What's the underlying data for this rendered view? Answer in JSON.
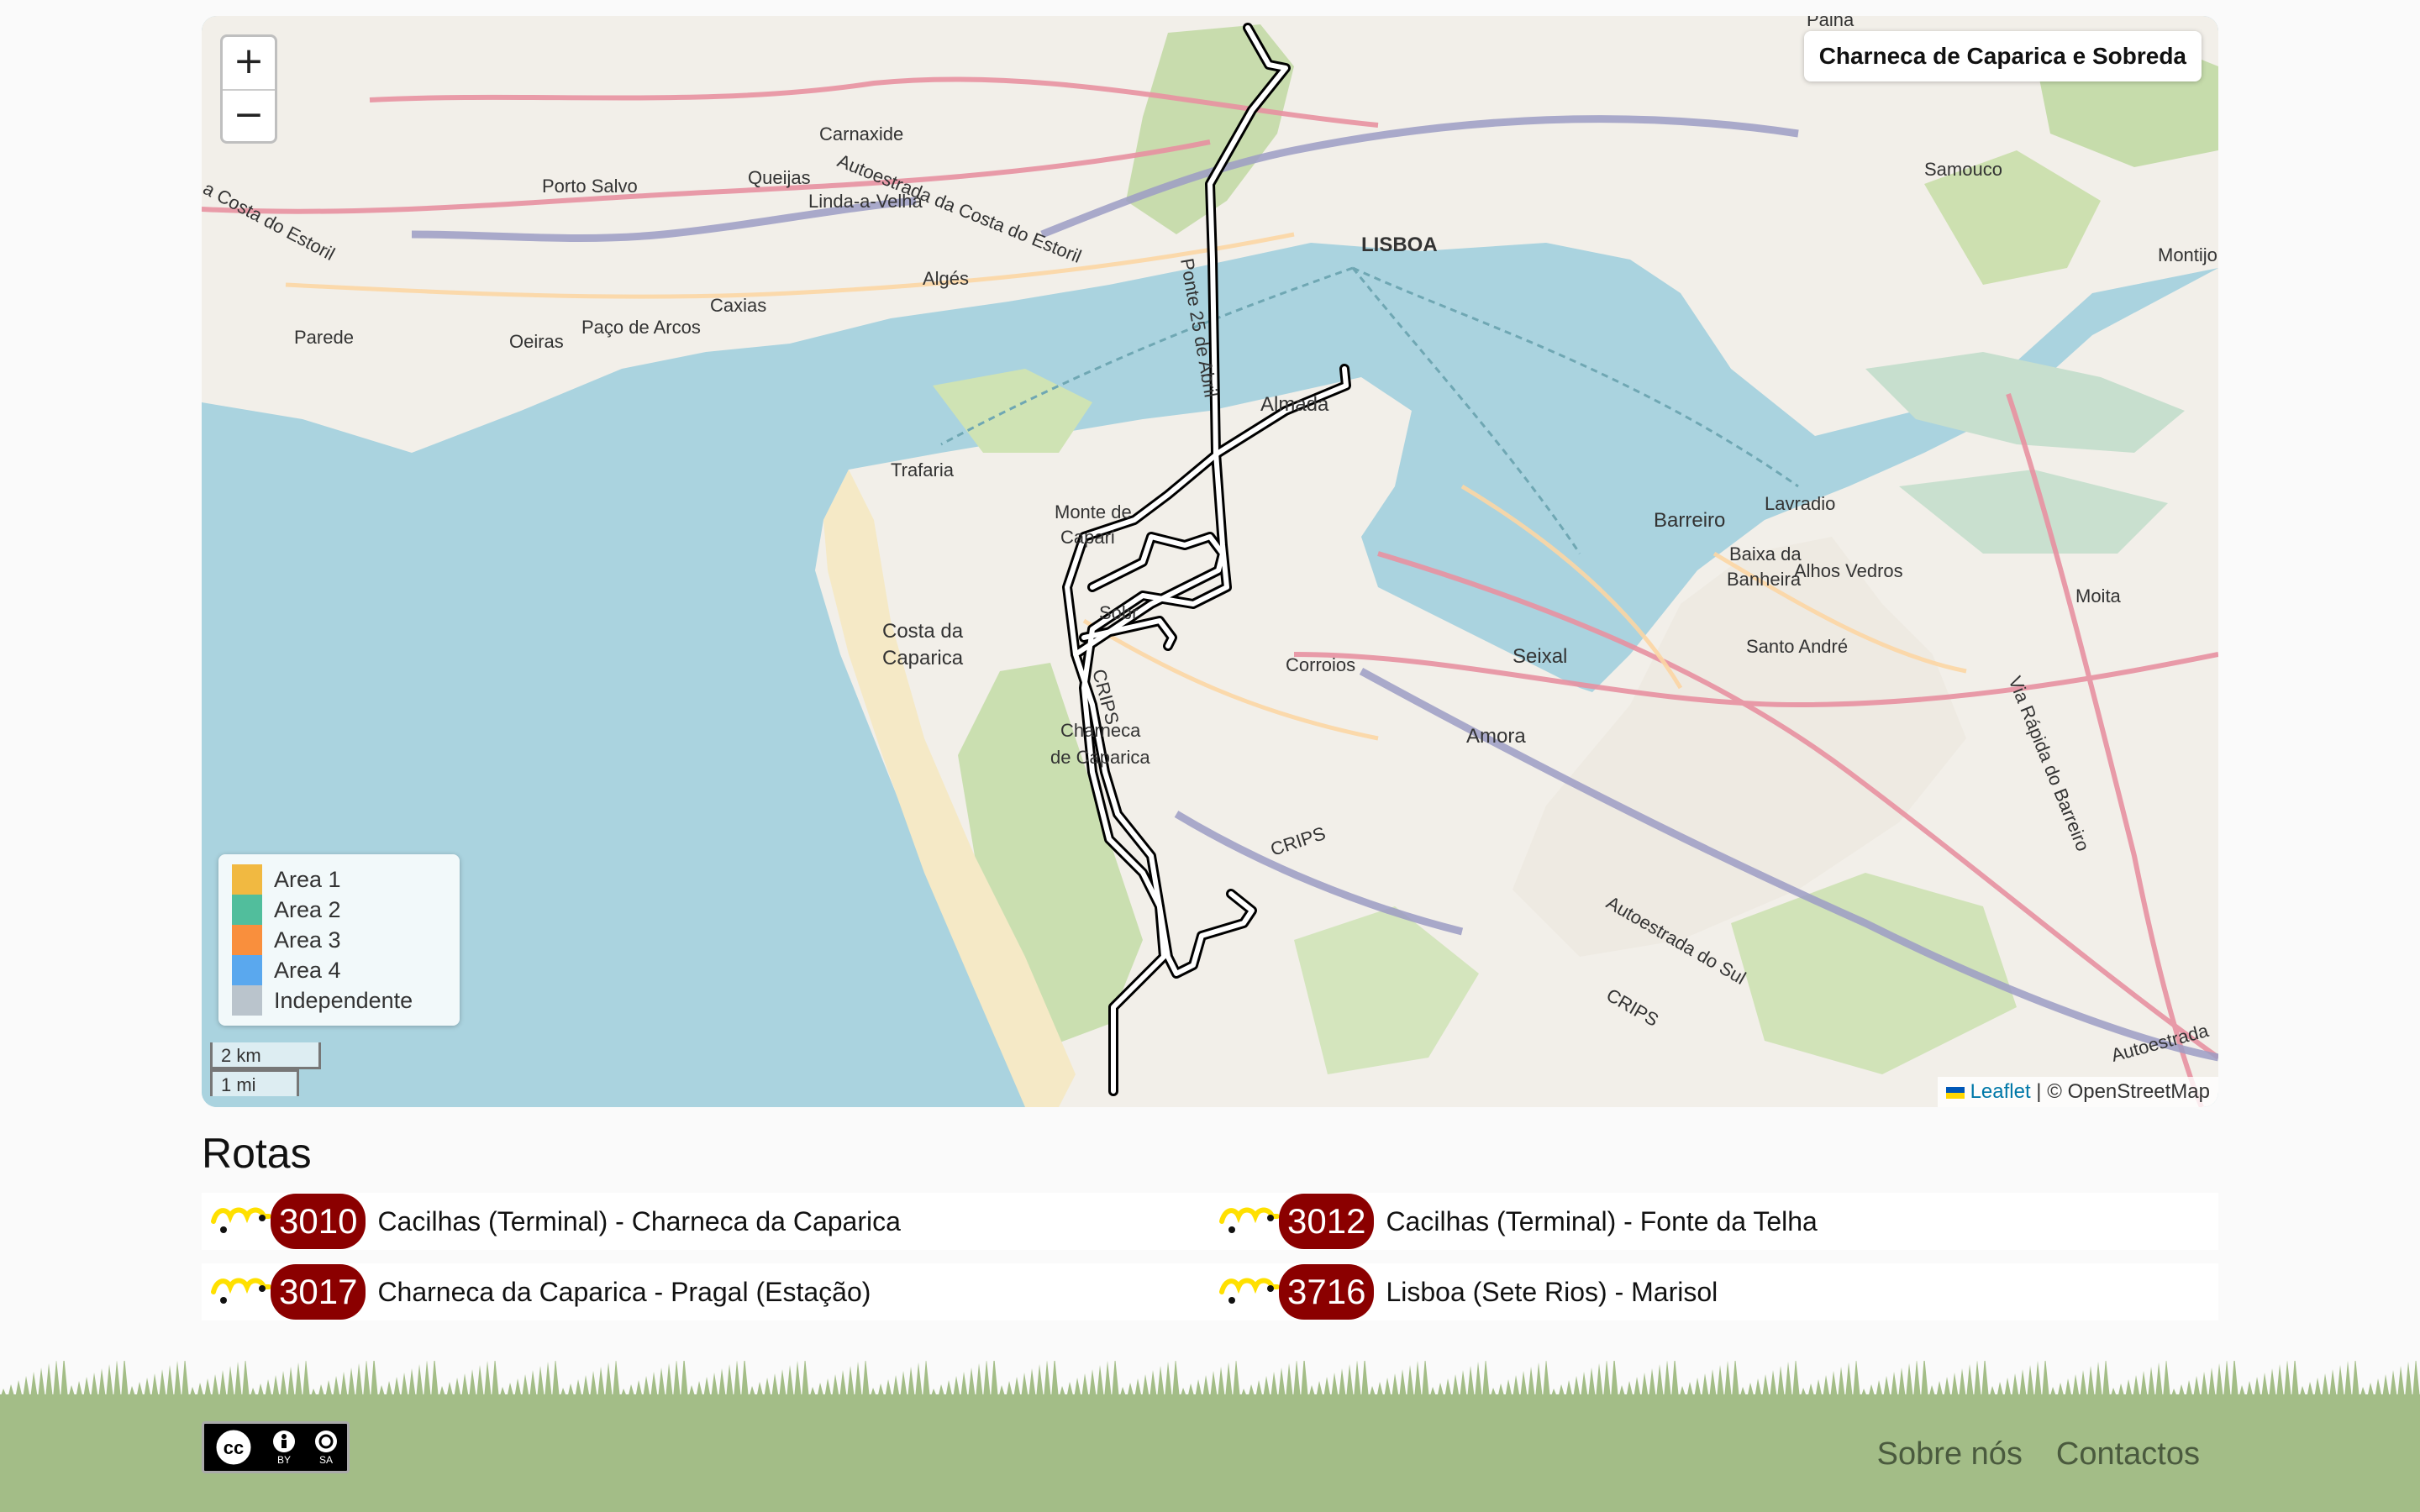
{
  "map": {
    "region_label": "Charneca de Caparica e Sobreda",
    "zoom_in": "+",
    "zoom_out": "−",
    "legend": [
      {
        "label": "Area 1",
        "color": "#f1b941"
      },
      {
        "label": "Area 2",
        "color": "#51be9c"
      },
      {
        "label": "Area 3",
        "color": "#f98f3d"
      },
      {
        "label": "Area 4",
        "color": "#5aa8ee"
      },
      {
        "label": "Independente",
        "color": "#bac4cc"
      }
    ],
    "scale_km": "2 km",
    "scale_mi": "1 mi",
    "attribution_leaflet": "Leaflet",
    "attribution_rest": " | © OpenStreetMap",
    "place_labels": {
      "palha": "Palha",
      "carnaxide": "Carnaxide",
      "porto_salvo": "Porto Salvo",
      "queijas": "Queijas",
      "linda": "Linda-a-Velha",
      "costa_estoril": "a Costa do Estoril",
      "autoestrada_estoril": "Autoestrada da Costa do Estoril",
      "alges": "Algés",
      "caxias": "Caxias",
      "pa_arcos": "Paço de Arcos",
      "oeiras": "Oeiras",
      "parede": "Parede",
      "lisboa": "LISBOA",
      "ponte": "Ponte 25 de Abril",
      "samouco": "Samouco",
      "montijo": "Montijo",
      "almada": "Almada",
      "trafaria": "Trafaria",
      "monte": "Monte de",
      "caparica_short": "Capari",
      "costa_da": "Costa da",
      "caparica": "Caparica",
      "barreiro": "Barreiro",
      "lavradio": "Lavradio",
      "baixa_da": "Baixa da",
      "banheira": "Banheira",
      "alhos_vedros": "Alhos Vedros",
      "moita": "Moita",
      "santo_andre": "Santo André",
      "seixal": "Seixal",
      "corroios": "Corroios",
      "amora": "Amora",
      "charneca": "Charneca",
      "de_caparica": "de Caparica",
      "crips1": "CRIPS",
      "crips2": "CRIPS",
      "crips3": "CRIPS",
      "via_rapida": "Via Rápida do Barreiro",
      "autoestrada_sul": "Autoestrada do Sul",
      "autoestrada_right": "Autoestrada",
      "sobreda": "Sobr"
    }
  },
  "section_title": "Rotas",
  "routes": [
    {
      "number": "3010",
      "name": "Cacilhas (Terminal) - Charneca da Caparica"
    },
    {
      "number": "3012",
      "name": "Cacilhas (Terminal) - Fonte da Telha"
    },
    {
      "number": "3017",
      "name": "Charneca da Caparica - Pragal (Estação)"
    },
    {
      "number": "3716",
      "name": "Lisboa (Sete Rios) - Marisol"
    }
  ],
  "footer": {
    "license_by": "BY",
    "license_sa": "SA",
    "links": [
      "Sobre nós",
      "Contactos"
    ]
  }
}
